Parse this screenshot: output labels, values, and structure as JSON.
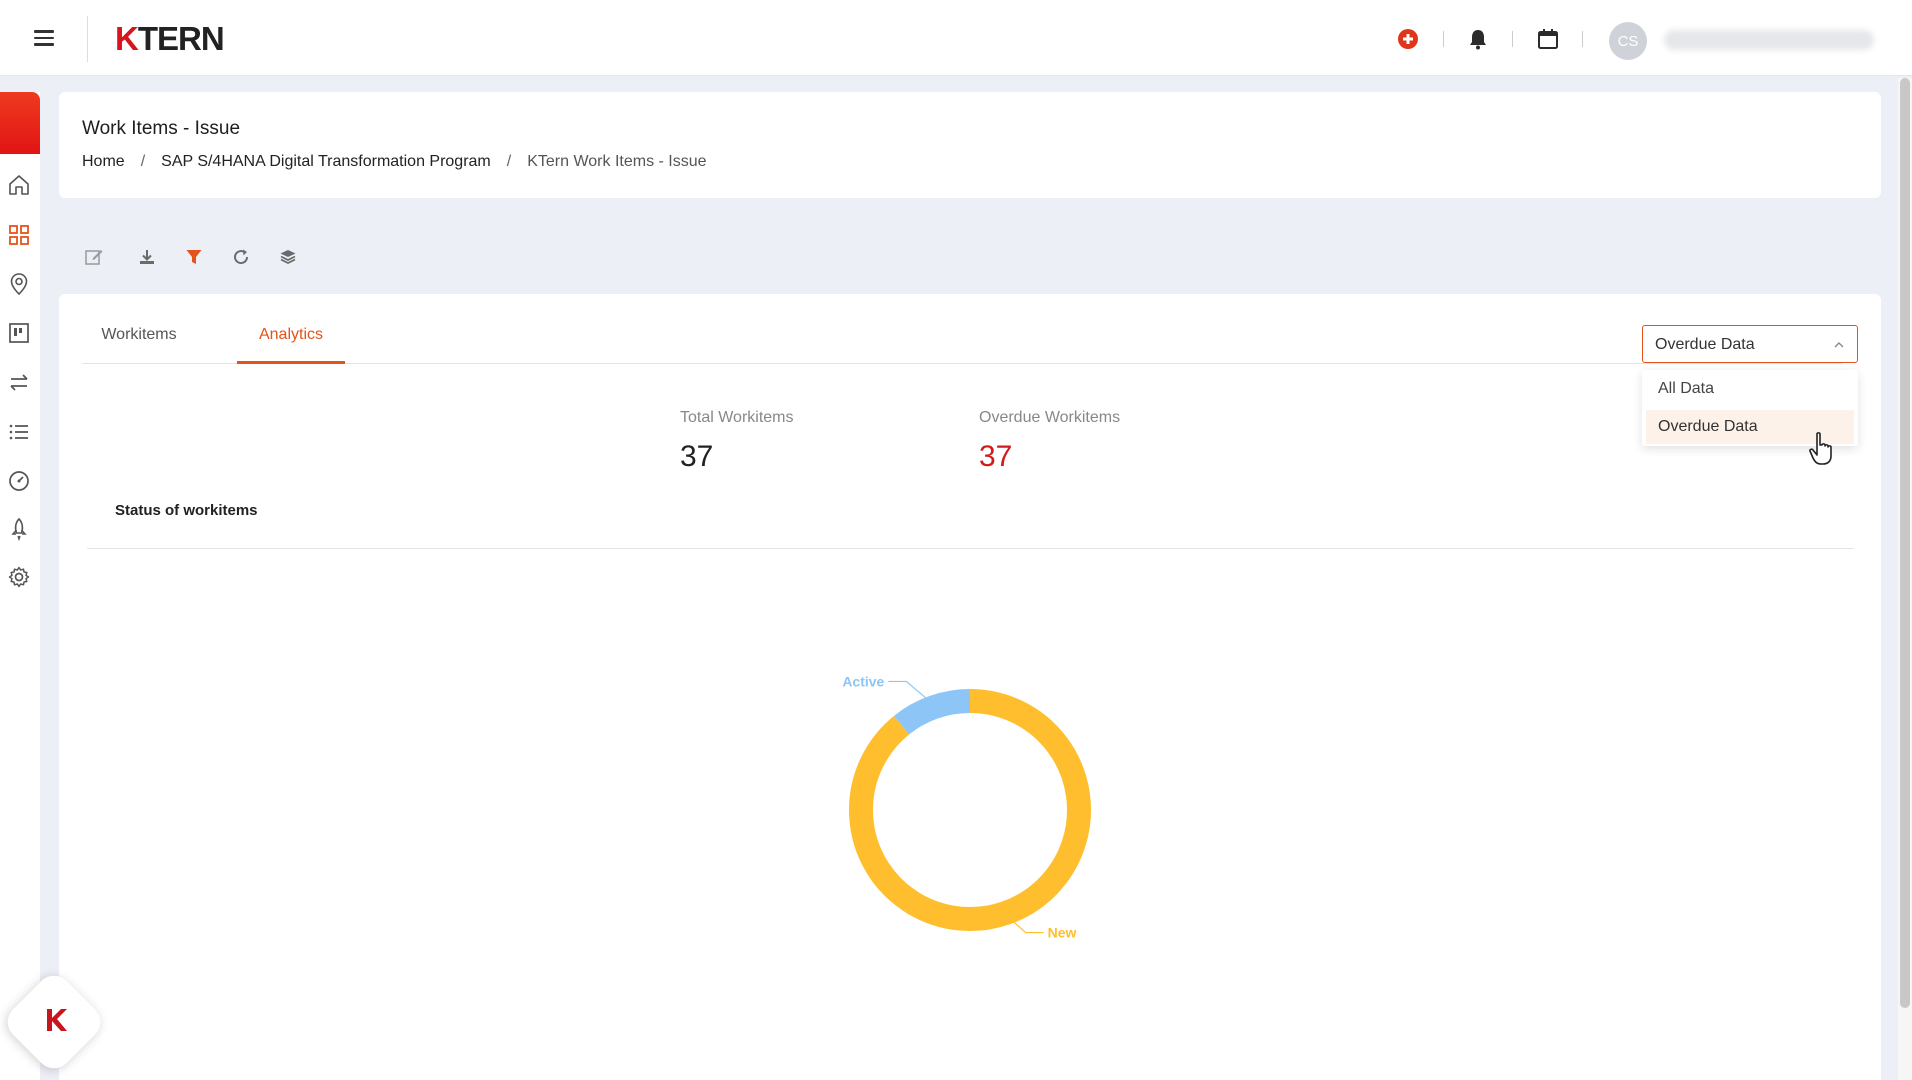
{
  "header": {
    "logo_k": "K",
    "logo_rest": "TERN",
    "avatar_initials": "CS"
  },
  "page": {
    "title": "Work Items - Issue",
    "breadcrumb": [
      "Home",
      "SAP S/4HANA Digital Transformation Program",
      "KTern Work Items - Issue"
    ],
    "breadcrumb_sep": "/"
  },
  "tabs": [
    {
      "label": "Workitems",
      "active": false
    },
    {
      "label": "Analytics",
      "active": true
    }
  ],
  "filter": {
    "selected": "Overdue Data",
    "options": [
      "All Data",
      "Overdue Data"
    ]
  },
  "stats": {
    "total_label": "Total Workitems",
    "total_value": "37",
    "overdue_label": "Overdue Workitems",
    "overdue_value": "37"
  },
  "section": {
    "title": "Status of workitems"
  },
  "chart_data": {
    "type": "pie",
    "donut": true,
    "categories": [
      "New",
      "Active"
    ],
    "values": [
      33,
      4
    ],
    "colors": [
      "#ffbe2e",
      "#8ec5f7"
    ],
    "labels": [
      "New",
      "Active"
    ]
  },
  "colors": {
    "accent": "#e3541b",
    "overdue": "#d21b1b"
  }
}
